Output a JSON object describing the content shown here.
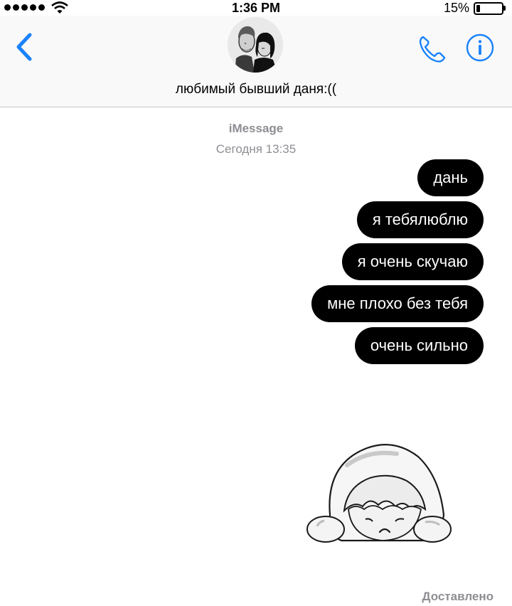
{
  "status_bar": {
    "time": "1:36 PM",
    "battery_percent": "15%",
    "battery_level": 0.15,
    "signal_bars": 5,
    "icons": [
      "signal-dots-icon",
      "wifi-icon",
      "battery-icon"
    ]
  },
  "header": {
    "contact_name": "любимый бывший даня:((",
    "icons": [
      "chevron-left-icon",
      "phone-icon",
      "info-icon"
    ],
    "accent_color": "#1a82fb"
  },
  "conversation": {
    "service": "iMessage",
    "timestamp": "Сегодня 13:35",
    "messages": [
      {
        "text": "дань"
      },
      {
        "text": "я тебялюблю"
      },
      {
        "text": "я очень скучаю"
      },
      {
        "text": "мне плохо без тебя"
      },
      {
        "text": "очень сильно"
      }
    ],
    "sticker": "sad-blob-sticker",
    "delivery_status": "Доставлено"
  },
  "colors": {
    "bubble": "#000000",
    "bubble_text": "#ffffff",
    "meta_text": "#8e8e93",
    "header_bg": "#f9f9f9"
  }
}
